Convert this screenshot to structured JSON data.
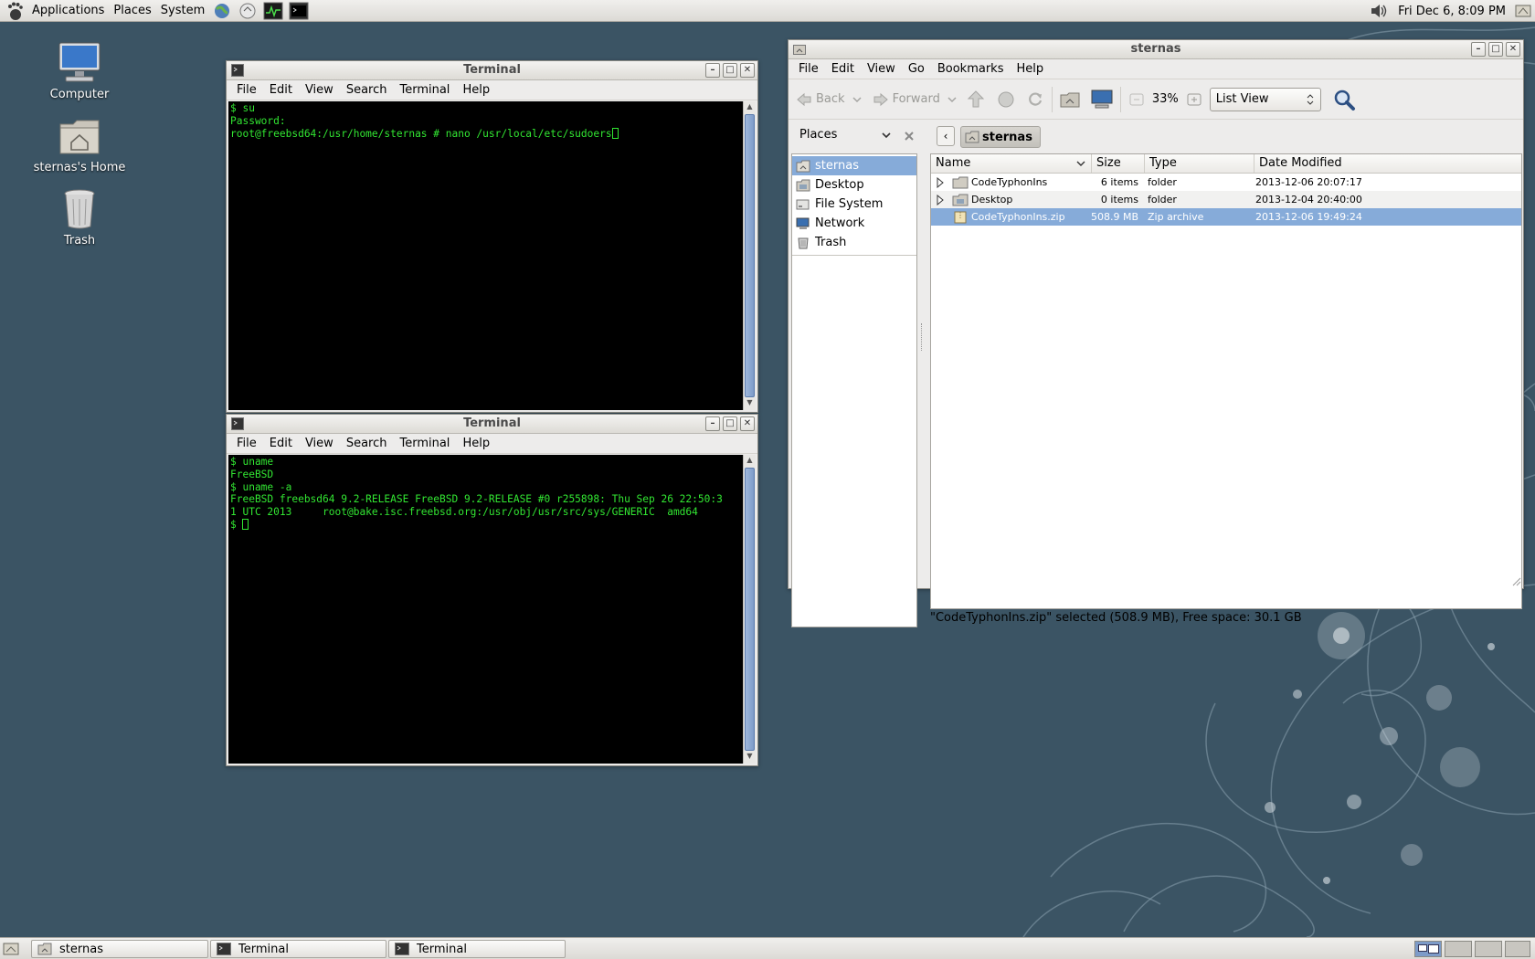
{
  "top_panel": {
    "menus": [
      "Applications",
      "Places",
      "System"
    ],
    "clock": "Fri Dec  6,  8:09 PM"
  },
  "desktop_icons": [
    {
      "label": "Computer",
      "icon": "computer-icon"
    },
    {
      "label": "sternas's Home",
      "icon": "home-folder-icon"
    },
    {
      "label": "Trash",
      "icon": "trash-icon"
    }
  ],
  "terminal_menu": [
    "File",
    "Edit",
    "View",
    "Search",
    "Terminal",
    "Help"
  ],
  "terminal1": {
    "title": "Terminal",
    "lines": [
      "$ su",
      "Password:",
      "root@freebsd64:/usr/home/sternas # nano /usr/local/etc/sudoers"
    ]
  },
  "terminal2": {
    "title": "Terminal",
    "lines": [
      "$ uname",
      "FreeBSD",
      "$ uname -a",
      "FreeBSD freebsd64 9.2-RELEASE FreeBSD 9.2-RELEASE #0 r255898: Thu Sep 26 22:50:3",
      "1 UTC 2013     root@bake.isc.freebsd.org:/usr/obj/usr/src/sys/GENERIC  amd64",
      "$ "
    ]
  },
  "nautilus": {
    "title": "sternas",
    "menu": [
      "File",
      "Edit",
      "View",
      "Go",
      "Bookmarks",
      "Help"
    ],
    "toolbar": {
      "back": "Back",
      "forward": "Forward",
      "zoom": "33%",
      "view_mode": "List View"
    },
    "sidebar_title": "Places",
    "places": [
      "sternas",
      "Desktop",
      "File System",
      "Network",
      "Trash"
    ],
    "location": "sternas",
    "columns": [
      "Name",
      "Size",
      "Type",
      "Date Modified"
    ],
    "files": [
      {
        "name": "CodeTyphonIns",
        "size": "6 items",
        "type": "folder",
        "date": "2013-12-06 20:07:17"
      },
      {
        "name": "Desktop",
        "size": "0 items",
        "type": "folder",
        "date": "2013-12-04 20:40:00"
      },
      {
        "name": "CodeTyphonIns.zip",
        "size": "508.9 MB",
        "type": "Zip archive",
        "date": "2013-12-06 19:49:24"
      }
    ],
    "status": "\"CodeTyphonIns.zip\" selected (508.9 MB), Free space: 30.1 GB"
  },
  "taskbar": [
    "sternas",
    "Terminal",
    "Terminal"
  ],
  "colors": {
    "desktop": "#3b5464",
    "terminal_bg": "#000000",
    "terminal_fg": "#32e632",
    "selection": "#86abd9"
  }
}
